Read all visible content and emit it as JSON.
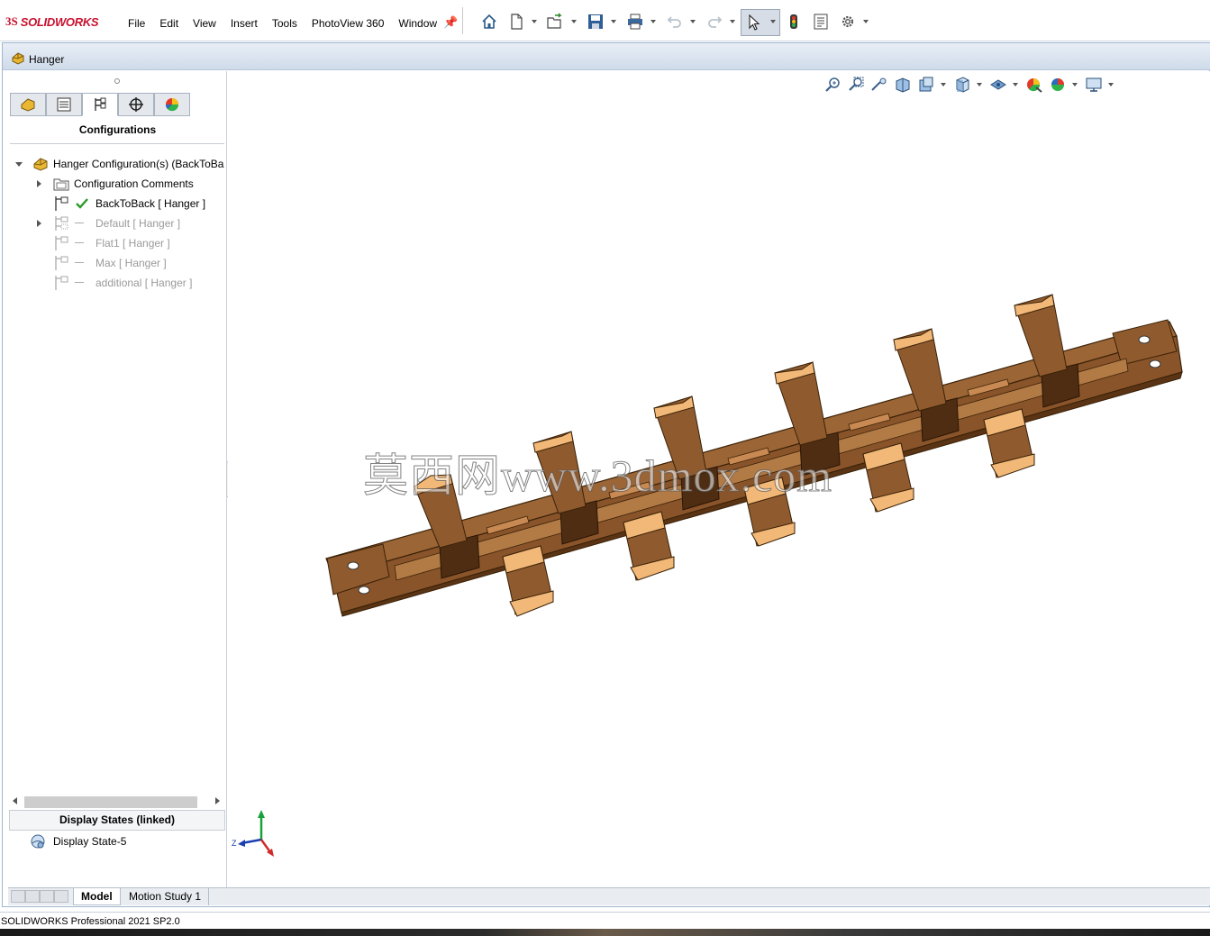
{
  "app": {
    "brand_prefix": "3S",
    "brand_name": "SOLIDWORKS"
  },
  "menu": {
    "items": [
      "File",
      "Edit",
      "View",
      "Insert",
      "Tools",
      "PhotoView 360",
      "Window"
    ]
  },
  "toolbar": {
    "icons": [
      "home-icon",
      "new-document-icon",
      "open-icon",
      "save-icon",
      "print-icon",
      "undo-icon",
      "redo-icon",
      "select-icon",
      "rebuild-icon",
      "file-properties-icon",
      "options-icon"
    ]
  },
  "document": {
    "title": "Hanger"
  },
  "panel": {
    "tabs": [
      "feature-manager-tab",
      "property-manager-tab",
      "configuration-manager-tab",
      "dimxpert-manager-tab",
      "display-manager-tab"
    ],
    "title": "Configurations",
    "tree": {
      "root": "Hanger Configuration(s)  (BackToBa",
      "comments": "Configuration Comments",
      "configs": [
        {
          "label": "BackToBack [ Hanger ]",
          "active": true
        },
        {
          "label": "Default [ Hanger ]",
          "active": false
        },
        {
          "label": "Flat1 [ Hanger ]",
          "active": false
        },
        {
          "label": "Max [ Hanger ]",
          "active": false
        },
        {
          "label": "additional [ Hanger ]",
          "active": false
        }
      ]
    },
    "display_states": {
      "header": "Display States (linked)",
      "item": "Display State-5"
    }
  },
  "viewport": {
    "watermark": "莫西网www.3dmox.com",
    "triad": {
      "z_label": "Z"
    },
    "colors": {
      "face": "#8f5a2e",
      "dark": "#5a3414",
      "light": "#f2b877",
      "mid": "#b27a45"
    }
  },
  "bottom_tabs": {
    "model": "Model",
    "motion": "Motion Study 1"
  },
  "status": {
    "text": "SOLIDWORKS Professional 2021 SP2.0"
  }
}
